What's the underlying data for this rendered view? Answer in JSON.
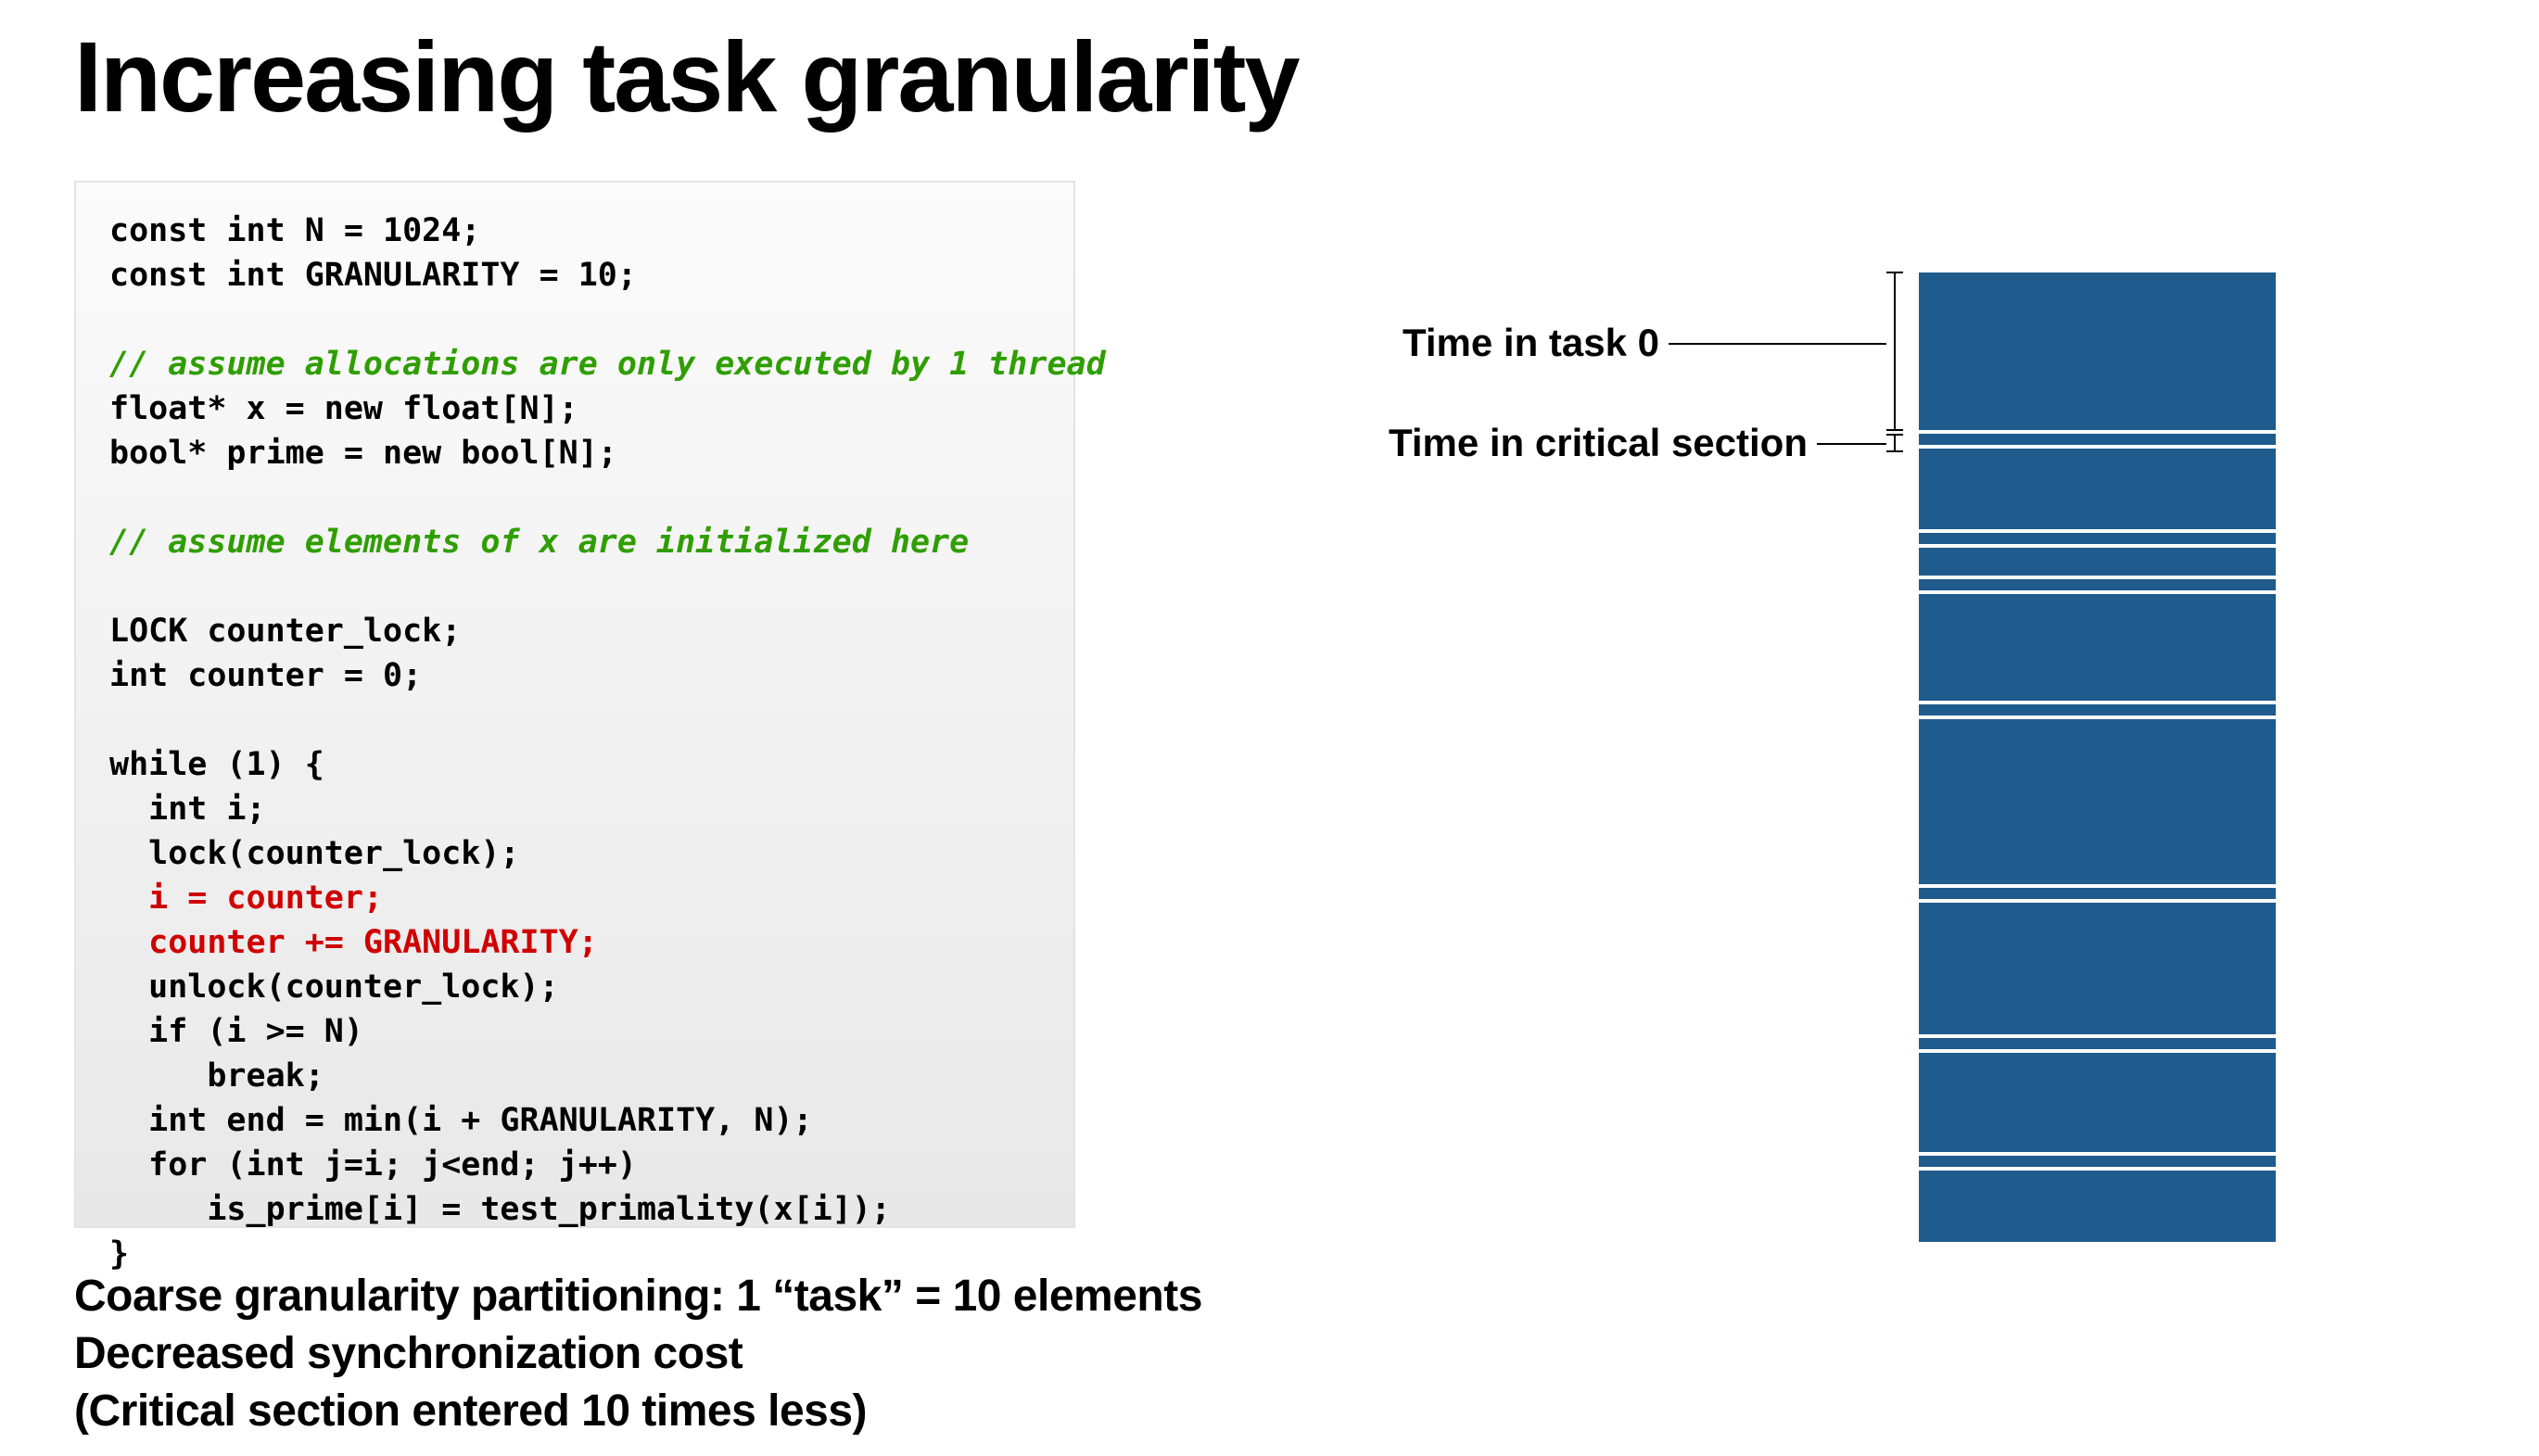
{
  "title": "Increasing task granularity",
  "code": {
    "l1": "const int N = 1024;",
    "l2": "const int GRANULARITY = 10;",
    "l3": "",
    "c1": "// assume allocations are only executed by 1 thread",
    "l4": "float* x = new float[N];",
    "l5": "bool* prime = new bool[N];",
    "l6": "",
    "c2": "// assume elements of x are initialized here",
    "l7": "",
    "l8": "LOCK counter_lock;",
    "l9": "int counter = 0;",
    "l10": "",
    "l11": "while (1) {",
    "l12": "  int i;",
    "l13": "  lock(counter_lock);",
    "r1": "  i = counter;",
    "r2": "  counter += GRANULARITY;",
    "l14": "  unlock(counter_lock);",
    "l15": "  if (i >= N)",
    "l16": "     break;",
    "l17": "  int end = min(i + GRANULARITY, N);",
    "l18": "  for (int j=i; j<end; j++)",
    "l19": "     is_prime[i] = test_primality(x[i]);",
    "l20": "}"
  },
  "caption": {
    "line1": "Coarse granularity partitioning: 1 “task” = 10 elements",
    "line2": "Decreased synchronization cost",
    "line3": "(Critical section entered 10 times less)"
  },
  "labels": {
    "task0": "Time in task 0",
    "crit": "Time in critical section"
  },
  "diagram": {
    "full_height": 1000,
    "crit_gap": 12,
    "task_heights": [
      170,
      87,
      30,
      115,
      178,
      142,
      107,
      77
    ],
    "colors": {
      "bar": "#1f5b8d"
    }
  }
}
